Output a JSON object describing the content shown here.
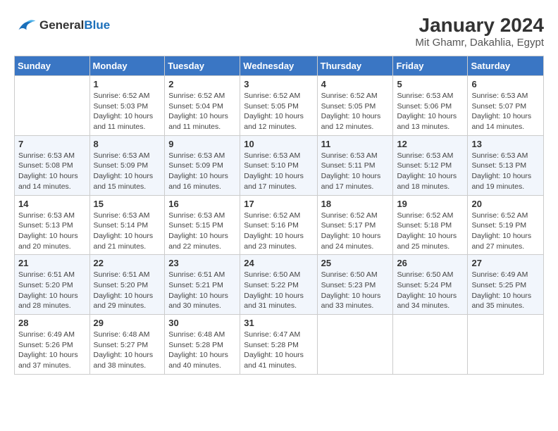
{
  "logo": {
    "line1": "General",
    "line2": "Blue"
  },
  "title": "January 2024",
  "location": "Mit Ghamr, Dakahlia, Egypt",
  "weekdays": [
    "Sunday",
    "Monday",
    "Tuesday",
    "Wednesday",
    "Thursday",
    "Friday",
    "Saturday"
  ],
  "weeks": [
    [
      {
        "day": "",
        "info": ""
      },
      {
        "day": "1",
        "info": "Sunrise: 6:52 AM\nSunset: 5:03 PM\nDaylight: 10 hours\nand 11 minutes."
      },
      {
        "day": "2",
        "info": "Sunrise: 6:52 AM\nSunset: 5:04 PM\nDaylight: 10 hours\nand 11 minutes."
      },
      {
        "day": "3",
        "info": "Sunrise: 6:52 AM\nSunset: 5:05 PM\nDaylight: 10 hours\nand 12 minutes."
      },
      {
        "day": "4",
        "info": "Sunrise: 6:52 AM\nSunset: 5:05 PM\nDaylight: 10 hours\nand 12 minutes."
      },
      {
        "day": "5",
        "info": "Sunrise: 6:53 AM\nSunset: 5:06 PM\nDaylight: 10 hours\nand 13 minutes."
      },
      {
        "day": "6",
        "info": "Sunrise: 6:53 AM\nSunset: 5:07 PM\nDaylight: 10 hours\nand 14 minutes."
      }
    ],
    [
      {
        "day": "7",
        "info": "Sunrise: 6:53 AM\nSunset: 5:08 PM\nDaylight: 10 hours\nand 14 minutes."
      },
      {
        "day": "8",
        "info": "Sunrise: 6:53 AM\nSunset: 5:09 PM\nDaylight: 10 hours\nand 15 minutes."
      },
      {
        "day": "9",
        "info": "Sunrise: 6:53 AM\nSunset: 5:09 PM\nDaylight: 10 hours\nand 16 minutes."
      },
      {
        "day": "10",
        "info": "Sunrise: 6:53 AM\nSunset: 5:10 PM\nDaylight: 10 hours\nand 17 minutes."
      },
      {
        "day": "11",
        "info": "Sunrise: 6:53 AM\nSunset: 5:11 PM\nDaylight: 10 hours\nand 17 minutes."
      },
      {
        "day": "12",
        "info": "Sunrise: 6:53 AM\nSunset: 5:12 PM\nDaylight: 10 hours\nand 18 minutes."
      },
      {
        "day": "13",
        "info": "Sunrise: 6:53 AM\nSunset: 5:13 PM\nDaylight: 10 hours\nand 19 minutes."
      }
    ],
    [
      {
        "day": "14",
        "info": "Sunrise: 6:53 AM\nSunset: 5:13 PM\nDaylight: 10 hours\nand 20 minutes."
      },
      {
        "day": "15",
        "info": "Sunrise: 6:53 AM\nSunset: 5:14 PM\nDaylight: 10 hours\nand 21 minutes."
      },
      {
        "day": "16",
        "info": "Sunrise: 6:53 AM\nSunset: 5:15 PM\nDaylight: 10 hours\nand 22 minutes."
      },
      {
        "day": "17",
        "info": "Sunrise: 6:52 AM\nSunset: 5:16 PM\nDaylight: 10 hours\nand 23 minutes."
      },
      {
        "day": "18",
        "info": "Sunrise: 6:52 AM\nSunset: 5:17 PM\nDaylight: 10 hours\nand 24 minutes."
      },
      {
        "day": "19",
        "info": "Sunrise: 6:52 AM\nSunset: 5:18 PM\nDaylight: 10 hours\nand 25 minutes."
      },
      {
        "day": "20",
        "info": "Sunrise: 6:52 AM\nSunset: 5:19 PM\nDaylight: 10 hours\nand 27 minutes."
      }
    ],
    [
      {
        "day": "21",
        "info": "Sunrise: 6:51 AM\nSunset: 5:20 PM\nDaylight: 10 hours\nand 28 minutes."
      },
      {
        "day": "22",
        "info": "Sunrise: 6:51 AM\nSunset: 5:20 PM\nDaylight: 10 hours\nand 29 minutes."
      },
      {
        "day": "23",
        "info": "Sunrise: 6:51 AM\nSunset: 5:21 PM\nDaylight: 10 hours\nand 30 minutes."
      },
      {
        "day": "24",
        "info": "Sunrise: 6:50 AM\nSunset: 5:22 PM\nDaylight: 10 hours\nand 31 minutes."
      },
      {
        "day": "25",
        "info": "Sunrise: 6:50 AM\nSunset: 5:23 PM\nDaylight: 10 hours\nand 33 minutes."
      },
      {
        "day": "26",
        "info": "Sunrise: 6:50 AM\nSunset: 5:24 PM\nDaylight: 10 hours\nand 34 minutes."
      },
      {
        "day": "27",
        "info": "Sunrise: 6:49 AM\nSunset: 5:25 PM\nDaylight: 10 hours\nand 35 minutes."
      }
    ],
    [
      {
        "day": "28",
        "info": "Sunrise: 6:49 AM\nSunset: 5:26 PM\nDaylight: 10 hours\nand 37 minutes."
      },
      {
        "day": "29",
        "info": "Sunrise: 6:48 AM\nSunset: 5:27 PM\nDaylight: 10 hours\nand 38 minutes."
      },
      {
        "day": "30",
        "info": "Sunrise: 6:48 AM\nSunset: 5:28 PM\nDaylight: 10 hours\nand 40 minutes."
      },
      {
        "day": "31",
        "info": "Sunrise: 6:47 AM\nSunset: 5:28 PM\nDaylight: 10 hours\nand 41 minutes."
      },
      {
        "day": "",
        "info": ""
      },
      {
        "day": "",
        "info": ""
      },
      {
        "day": "",
        "info": ""
      }
    ]
  ]
}
